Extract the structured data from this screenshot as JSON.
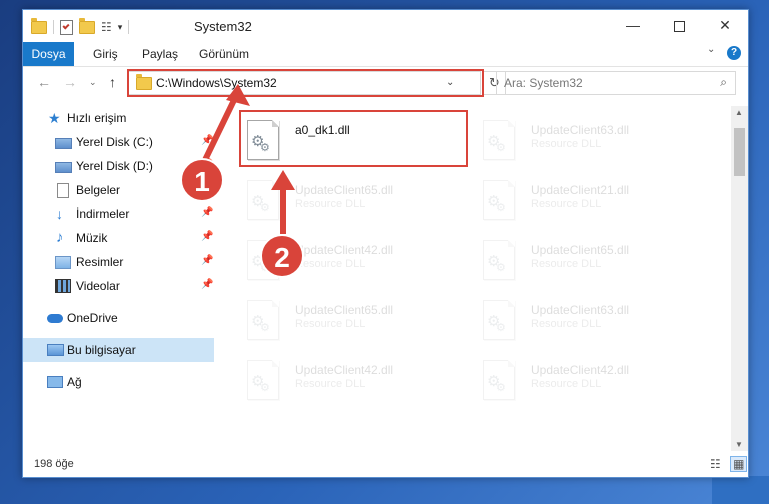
{
  "window": {
    "title": "System32",
    "controls": {
      "minimize": "—",
      "maximize": "",
      "close": "✕"
    }
  },
  "ribbon": {
    "tabs": [
      "Dosya",
      "Giriş",
      "Paylaş",
      "Görünüm"
    ],
    "expand": "⌄",
    "help": "?"
  },
  "navigation": {
    "back": "←",
    "forward": "→",
    "recent": "⌄",
    "up": "↑",
    "address": "C:\\Windows\\System32",
    "address_dropdown": "⌄",
    "refresh": "↻",
    "search_placeholder": "Ara: System32",
    "search_icon": "⌕"
  },
  "sidebar": {
    "items": [
      {
        "label": "Hızlı erişim",
        "icon": "star-icon",
        "glyph": "★",
        "pinned": false
      },
      {
        "label": "Yerel Disk (C:)",
        "icon": "disk-icon",
        "glyph": "",
        "pinned": true
      },
      {
        "label": "Yerel Disk (D:)",
        "icon": "disk-icon",
        "glyph": "",
        "pinned": true
      },
      {
        "label": "Belgeler",
        "icon": "document-icon",
        "glyph": "",
        "pinned": true
      },
      {
        "label": "İndirmeler",
        "icon": "download-icon",
        "glyph": "↓",
        "pinned": true
      },
      {
        "label": "Müzik",
        "icon": "music-icon",
        "glyph": "♪",
        "pinned": true
      },
      {
        "label": "Resimler",
        "icon": "pictures-icon",
        "glyph": "",
        "pinned": true
      },
      {
        "label": "Videolar",
        "icon": "videos-icon",
        "glyph": "",
        "pinned": true
      },
      {
        "label": "OneDrive",
        "icon": "cloud-icon",
        "glyph": "",
        "pinned": false
      },
      {
        "label": "Bu bilgisayar",
        "icon": "computer-icon",
        "glyph": "",
        "pinned": false,
        "selected": true
      },
      {
        "label": "Ağ",
        "icon": "network-icon",
        "glyph": "",
        "pinned": false
      }
    ],
    "pin_glyph": "📌"
  },
  "files": {
    "highlighted": {
      "name": "a0_dk1.dll",
      "type": ""
    },
    "faded": [
      {
        "name": "UpdateClient63.dll",
        "type": "Resource DLL"
      },
      {
        "name": "UpdateClient65.dll",
        "type": "Resource DLL"
      },
      {
        "name": "UpdateClient21.dll",
        "type": "Resource DLL"
      },
      {
        "name": "UpdateClient42.dll",
        "type": "Resource DLL"
      },
      {
        "name": "UpdateClient65.dll",
        "type": "Resource DLL"
      },
      {
        "name": "UpdateClient65.dll",
        "type": "Resource DLL"
      },
      {
        "name": "UpdateClient63.dll",
        "type": "Resource DLL"
      },
      {
        "name": "UpdateClient42.dll",
        "type": "Resource DLL"
      },
      {
        "name": "UpdateClient42.dll",
        "type": "Resource DLL"
      }
    ]
  },
  "status": {
    "item_count": "198 öğe",
    "view_details": "☷",
    "view_icons": "▦"
  },
  "steps": [
    "1",
    "2"
  ],
  "colors": {
    "accent": "#1979ca",
    "highlight": "#d9443a",
    "selected": "#cce4f7"
  }
}
